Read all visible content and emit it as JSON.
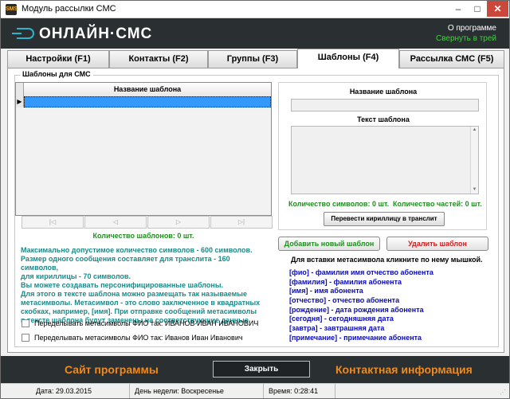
{
  "window": {
    "title": "Модуль рассылки СМС",
    "icon_text": "SMS",
    "min_symbol": "–",
    "max_symbol": "□",
    "close_symbol": "✕"
  },
  "header": {
    "logo_text": "ОНЛАЙН·СМС",
    "about_link": "О программе",
    "tray_link": "Свернуть в трей"
  },
  "tabs": [
    {
      "label": "Настройки (F1)",
      "active": false
    },
    {
      "label": "Контакты (F2)",
      "active": false
    },
    {
      "label": "Группы (F3)",
      "active": false
    },
    {
      "label": "Шаблоны (F4)",
      "active": true
    },
    {
      "label": "Рассылка СМС (F5)",
      "active": false
    }
  ],
  "templates": {
    "group_title": "Шаблоны для СМС",
    "grid_column": "Название шаблона",
    "row_marker": "▶",
    "nav": [
      "|◁",
      "◁",
      "▷",
      "▷|"
    ],
    "count_label": "Количество шаблонов: 0 шт.",
    "info_lines": [
      "Максимально допустимое количество символов - 600 символов.",
      "Размер одного сообщения составляет для транслита - 160 символов,",
      "для кириллицы - 70 символов.",
      "Вы можете создавать персонифицированные шаблоны.",
      "Для этого в тексте шаблона можно размещать так называемые",
      "метасимволы. Метасимвол - это слово заключенное в квадратных",
      "скобках, например, [имя]. При отправке сообщений метасимволы",
      "в тексте шаблона будут заменены на соответствующие данные."
    ],
    "checkbox1": "Переделывать метасимволы ФИО так: ИВАНОВ ИВАН ИВАНОВИЧ",
    "checkbox2": "Переделывать метасимволы ФИО так: Иванов Иван Иванович"
  },
  "editor": {
    "name_label": "Название шаблона",
    "text_label": "Текст шаблона",
    "name_value": "",
    "text_value": "",
    "chars_count": "Количество символов: 0 шт.",
    "parts_count": "Количество частей: 0 шт.",
    "translit_button": "Перевести кириллицу в транслит",
    "add_button": "Добавить новый шаблон",
    "delete_button": "Удалить шаблон",
    "meta_hint": "Для вставки метасимвола кликните по нему мышкой.",
    "meta_items": [
      "[фио] - фамилия имя отчество абонента",
      "[фамилия] - фамилия абонента",
      "[имя] - имя абонента",
      "[отчество] - отчество абонента",
      "[рождение] - дата рождения абонента",
      "[сегодня] - сегодняшняя дата",
      "[завтра] - завтрашняя дата",
      "[примечание] - примечание абонента"
    ]
  },
  "footer": {
    "site_link": "Сайт программы",
    "close_button": "Закрыть",
    "contact_link": "Контактная информация"
  },
  "status": {
    "date": "Дата: 29.03.2015",
    "weekday": "День недели: Воскресенье",
    "time": "Время: 0:28:41"
  },
  "colors": {
    "header_bg": "#2a2f31",
    "logo_accent": "#2fb3c9",
    "green_text": "#1f8f1f",
    "teal_info": "#1a8a8a",
    "meta_blue": "#0a0ab8",
    "footer_orange": "#f08a1c",
    "delete_red": "#d11c1c"
  }
}
